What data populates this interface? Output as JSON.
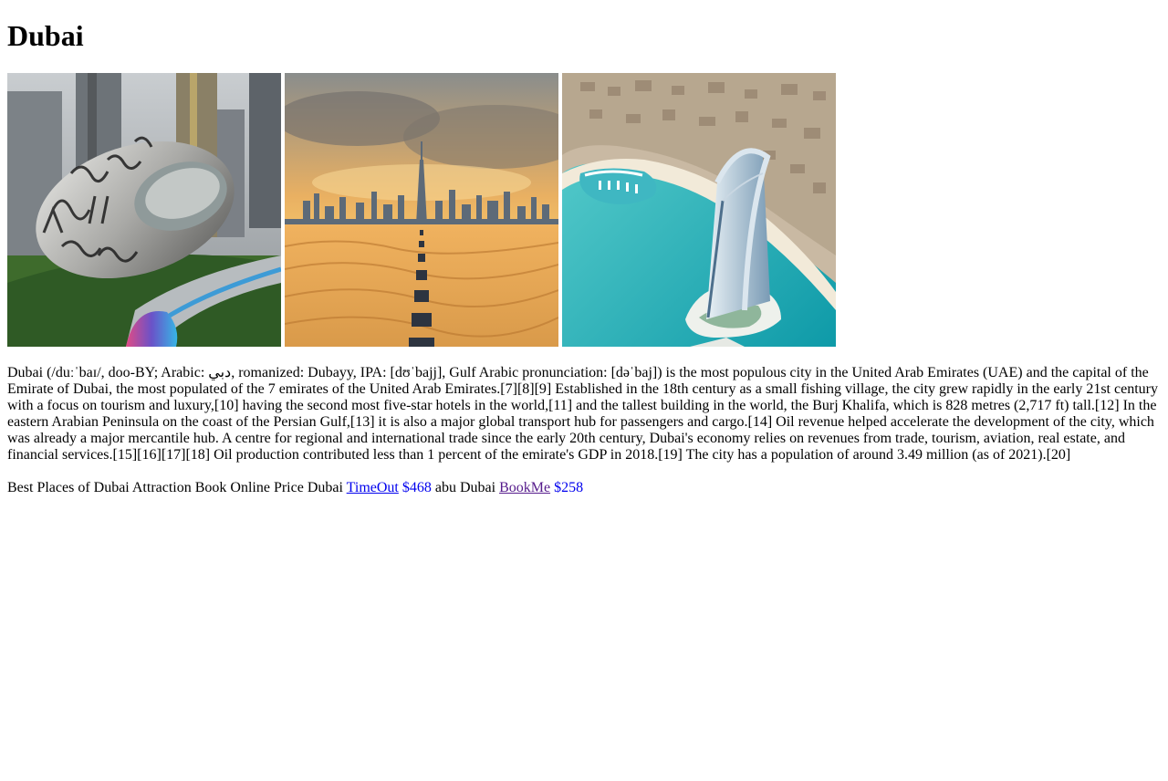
{
  "page": {
    "title": "Dubai"
  },
  "gallery": [
    {
      "icon": "museum-of-the-future-photo"
    },
    {
      "icon": "desert-skyline-photo"
    },
    {
      "icon": "burj-al-arab-photo"
    }
  ],
  "intro": {
    "text": "Dubai (/duːˈbaɪ/, doo-BY; Arabic: دبي, romanized: Dubayy, IPA: [dʊˈbajj], Gulf Arabic pronunciation: [dəˈbaj]) is the most populous city in the United Arab Emirates (UAE) and the capital of the Emirate of Dubai, the most populated of the 7 emirates of the United Arab Emirates.[7][8][9] Established in the 18th century as a small fishing village, the city grew rapidly in the early 21st century with a focus on tourism and luxury,[10] having the second most five-star hotels in the world,[11] and the tallest building in the world, the Burj Khalifa, which is 828 metres (2,717 ft) tall.[12] In the eastern Arabian Peninsula on the coast of the Persian Gulf,[13] it is also a major global transport hub for passengers and cargo.[14] Oil revenue helped accelerate the development of the city, which was already a major mercantile hub. A centre for regional and international trade since the early 20th century, Dubai's economy relies on revenues from trade, tourism, aviation, real estate, and financial services.[15][16][17][18] Oil production contributed less than 1 percent of the emirate's GDP in 2018.[19] The city has a population of around 3.49 million (as of 2021).[20]"
  },
  "offers": {
    "lead": "Best Places of Dubai Attraction Book Online Price Dubai",
    "link1": "TimeOut",
    "price1": "$468",
    "middle": "abu Dubai",
    "link2": "BookMe",
    "price2": "$258"
  },
  "colors": {
    "link": "#0000ee",
    "visited_link": "#551a8b"
  }
}
